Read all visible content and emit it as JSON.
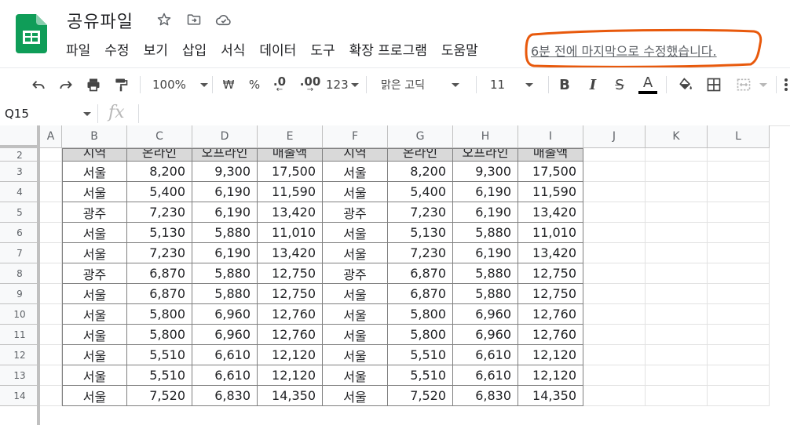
{
  "doc_title": "공유파일",
  "menu": [
    "파일",
    "수정",
    "보기",
    "삽입",
    "서식",
    "데이터",
    "도구",
    "확장 프로그램",
    "도움말"
  ],
  "last_edit": "6분 전에 마지막으로 수정했습니다.",
  "annotation_color": "#e8590c",
  "brand_color": "#0f9d58",
  "toolbar": {
    "zoom": "100%",
    "currency": "₩",
    "percent": "%",
    "decrease_decimal": ".0",
    "increase_decimal": ".00",
    "format_more": "123",
    "font": "맑은 고딕",
    "font_size": "11",
    "bold": "B",
    "italic": "I",
    "strike": "S",
    "text_color": "A"
  },
  "formula_bar": {
    "cell_ref": "Q15",
    "fx": "fx",
    "value": ""
  },
  "columns": [
    "A",
    "B",
    "C",
    "D",
    "E",
    "F",
    "G",
    "H",
    "I",
    "J",
    "K",
    "L"
  ],
  "rows": [
    "2",
    "3",
    "4",
    "5",
    "6",
    "7",
    "8",
    "9",
    "10",
    "11",
    "12",
    "13",
    "14"
  ],
  "table": {
    "headers": [
      "지역",
      "온라인",
      "오프라인",
      "매출액",
      "지역",
      "온라인",
      "오프라인",
      "매출액"
    ],
    "data": [
      [
        "서울",
        "8,200",
        "9,300",
        "17,500",
        "서울",
        "8,200",
        "9,300",
        "17,500"
      ],
      [
        "서울",
        "5,400",
        "6,190",
        "11,590",
        "서울",
        "5,400",
        "6,190",
        "11,590"
      ],
      [
        "광주",
        "7,230",
        "6,190",
        "13,420",
        "광주",
        "7,230",
        "6,190",
        "13,420"
      ],
      [
        "서울",
        "5,130",
        "5,880",
        "11,010",
        "서울",
        "5,130",
        "5,880",
        "11,010"
      ],
      [
        "서울",
        "7,230",
        "6,190",
        "13,420",
        "서울",
        "7,230",
        "6,190",
        "13,420"
      ],
      [
        "광주",
        "6,870",
        "5,880",
        "12,750",
        "광주",
        "6,870",
        "5,880",
        "12,750"
      ],
      [
        "서울",
        "6,870",
        "5,880",
        "12,750",
        "서울",
        "6,870",
        "5,880",
        "12,750"
      ],
      [
        "서울",
        "5,800",
        "6,960",
        "12,760",
        "서울",
        "5,800",
        "6,960",
        "12,760"
      ],
      [
        "서울",
        "5,800",
        "6,960",
        "12,760",
        "서울",
        "5,800",
        "6,960",
        "12,760"
      ],
      [
        "서울",
        "5,510",
        "6,610",
        "12,120",
        "서울",
        "5,510",
        "6,610",
        "12,120"
      ],
      [
        "서울",
        "5,510",
        "6,610",
        "12,120",
        "서울",
        "5,510",
        "6,610",
        "12,120"
      ],
      [
        "서울",
        "7,520",
        "6,830",
        "14,350",
        "서울",
        "7,520",
        "6,830",
        "14,350"
      ]
    ]
  }
}
